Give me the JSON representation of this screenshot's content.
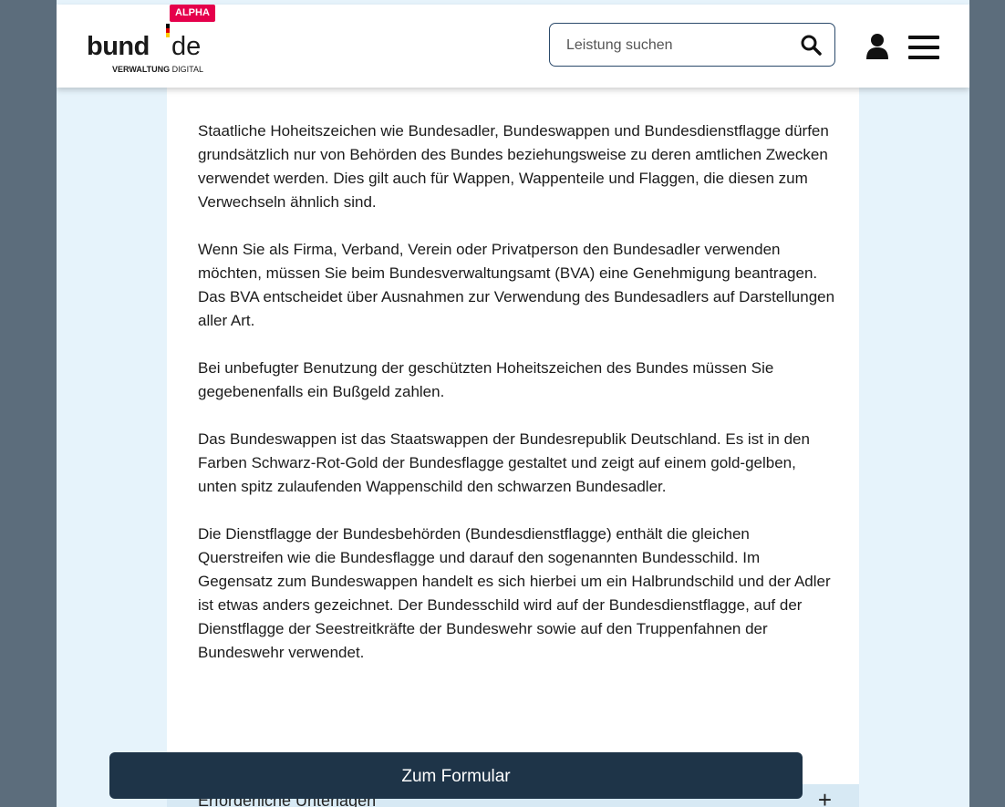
{
  "header": {
    "logo_main": "bund",
    "logo_domain": "de",
    "logo_sub_bold": "VERWALTUNG",
    "logo_sub_thin": " DIGITAL",
    "alpha_badge": "ALPHA",
    "search_placeholder": "Leistung suchen",
    "icons": {
      "search": "search-icon",
      "user": "user-icon",
      "menu": "hamburger-menu-icon"
    }
  },
  "colors": {
    "accent_dark": "#1e3448",
    "alpha_badge": "#e5004b",
    "flag_black": "#000000",
    "flag_red": "#dd0000",
    "flag_gold": "#ffcc00"
  },
  "content": {
    "paragraphs": [
      "Staatliche Hoheitszeichen wie Bundesadler, Bundeswappen und Bundesdienstflagge dürfen grundsätzlich nur von Behörden des Bundes beziehungsweise zu deren amtlichen Zwecken verwendet werden. Dies gilt auch für Wappen, Wappenteile und Flaggen, die diesen zum Verwechseln ähnlich sind.",
      "Wenn Sie als Firma, Verband, Verein oder Privatperson den Bundesadler verwenden möchten, müssen Sie beim Bundesverwaltungsamt (BVA) eine Genehmigung beantragen. Das BVA entscheidet über Ausnahmen zur Verwendung des Bundesadlers auf Darstellungen aller Art.",
      "Bei unbefugter Benutzung der geschützten Hoheitszeichen des Bundes müssen Sie gegebenenfalls ein Bußgeld zahlen.",
      "Das Bundeswappen ist das Staatswappen der Bundesrepublik Deutschland. Es ist in den Farben Schwarz-Rot-Gold der Bundesflagge gestaltet und zeigt auf einem gold-gelben, unten spitz zulaufenden Wappenschild den schwarzen Bundesadler.",
      "Die Dienstflagge der Bundesbehörden (Bundesdienstflagge) enthält die gleichen Querstreifen wie die Bundesflagge und darauf den sogenannten Bundesschild. Im Gegensatz zum Bundeswappen handelt es sich hierbei um ein Halbrundschild und der Adler ist etwas anders gezeichnet. Der Bundesschild wird auf der Bundesdienstflagge, auf der Dienstflagge der Seestreitkräfte der Bundeswehr sowie auf den Truppenfahnen der Bundeswehr verwendet."
    ]
  },
  "next_section": {
    "label": "Erforderliche Unterlagen",
    "toggle": "+"
  },
  "form_button": {
    "label": "Zum Formular"
  }
}
